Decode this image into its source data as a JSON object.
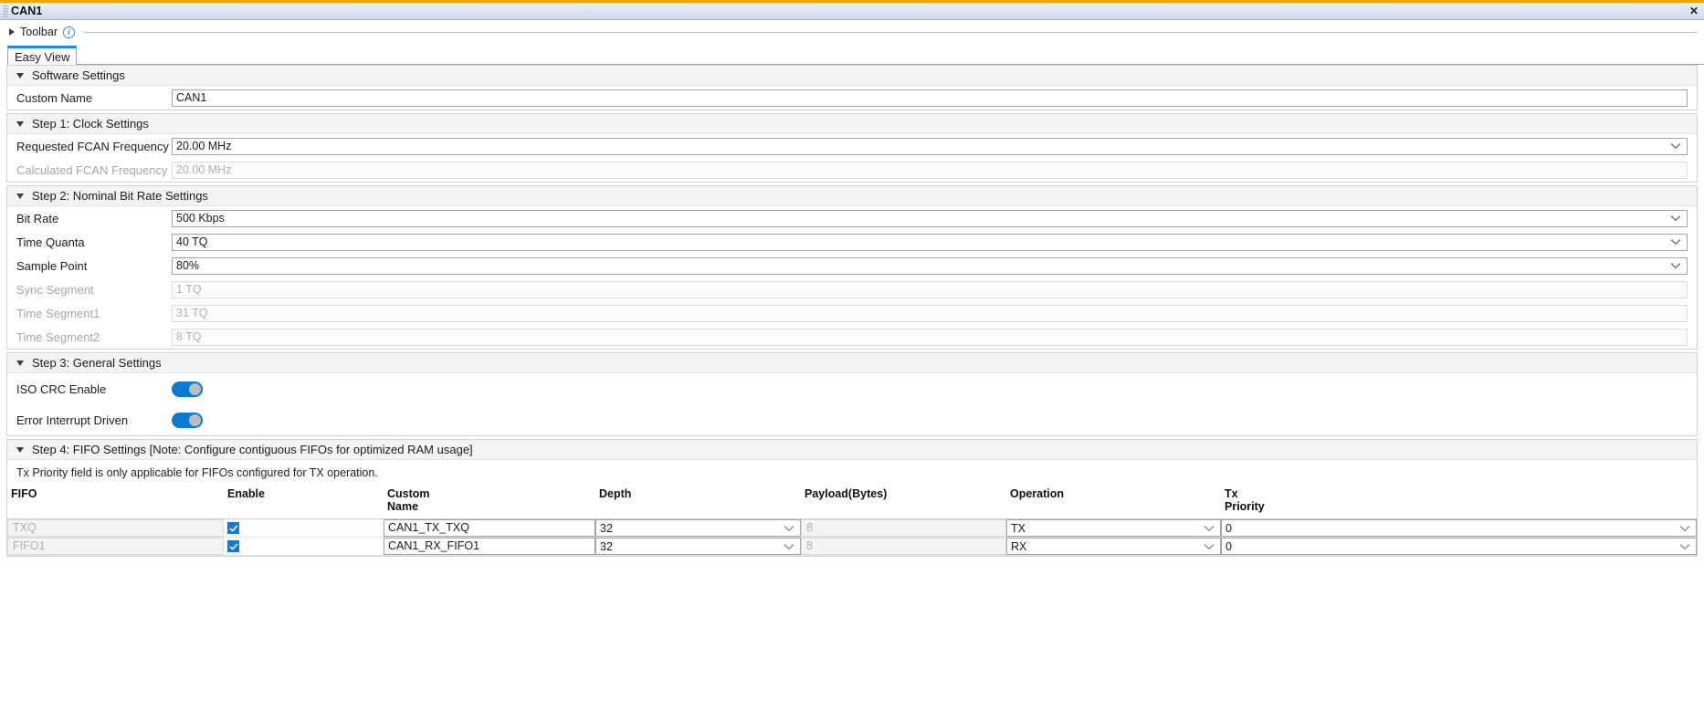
{
  "window": {
    "title": "CAN1",
    "close_label": "✕"
  },
  "toolbar": {
    "label": "Toolbar",
    "info_glyph": "i"
  },
  "tabs": [
    {
      "label": "Easy View",
      "active": true
    }
  ],
  "groups": {
    "software_settings": {
      "title": "Software Settings",
      "rows": [
        {
          "label": "Custom Name",
          "value": "CAN1",
          "type": "text",
          "disabled": false
        }
      ]
    },
    "step1": {
      "title": "Step 1: Clock Settings",
      "rows": [
        {
          "label": "Requested FCAN Frequency",
          "value": "20.00 MHz",
          "type": "select",
          "disabled": false
        },
        {
          "label": "Calculated FCAN Frequency",
          "value": "20.00 MHz",
          "type": "text",
          "disabled": true
        }
      ]
    },
    "step2": {
      "title": "Step 2: Nominal Bit Rate Settings",
      "rows": [
        {
          "label": "Bit Rate",
          "value": "500 Kbps",
          "type": "select",
          "disabled": false
        },
        {
          "label": "Time Quanta",
          "value": "40 TQ",
          "type": "select",
          "disabled": false
        },
        {
          "label": "Sample Point",
          "value": "80%",
          "type": "select",
          "disabled": false
        },
        {
          "label": "Sync Segment",
          "value": "1 TQ",
          "type": "text",
          "disabled": true
        },
        {
          "label": "Time Segment1",
          "value": "31 TQ",
          "type": "text",
          "disabled": true
        },
        {
          "label": "Time Segment2",
          "value": "8 TQ",
          "type": "text",
          "disabled": true
        }
      ]
    },
    "step3": {
      "title": "Step 3: General Settings",
      "rows": [
        {
          "label": "ISO CRC Enable",
          "type": "toggle",
          "value": "on"
        },
        {
          "label": "Error Interrupt Driven",
          "type": "toggle",
          "value": "on"
        }
      ]
    },
    "step4": {
      "title": "Step 4: FIFO Settings [Note: Configure contiguous FIFOs for optimized RAM usage]",
      "note": "Tx Priority field is only applicable for FIFOs configured for TX operation.",
      "columns": [
        "FIFO",
        "Enable",
        "Custom\nName",
        "Depth",
        "Payload(Bytes)",
        "Operation",
        "Tx\nPriority"
      ],
      "rows": [
        {
          "fifo": "TXQ",
          "enable": true,
          "custom_name": "CAN1_TX_TXQ",
          "depth": "32",
          "payload": "8",
          "operation": "TX",
          "tx_priority": "0"
        },
        {
          "fifo": "FIFO1",
          "enable": true,
          "custom_name": "CAN1_RX_FIFO1",
          "depth": "32",
          "payload": "8",
          "operation": "RX",
          "tx_priority": "0"
        }
      ]
    }
  },
  "colors": {
    "accent_orange": "#f0a500",
    "accent_blue": "#1a8fe0",
    "toggle_on": "#0a7bd4",
    "checkbox": "#1878d4"
  }
}
